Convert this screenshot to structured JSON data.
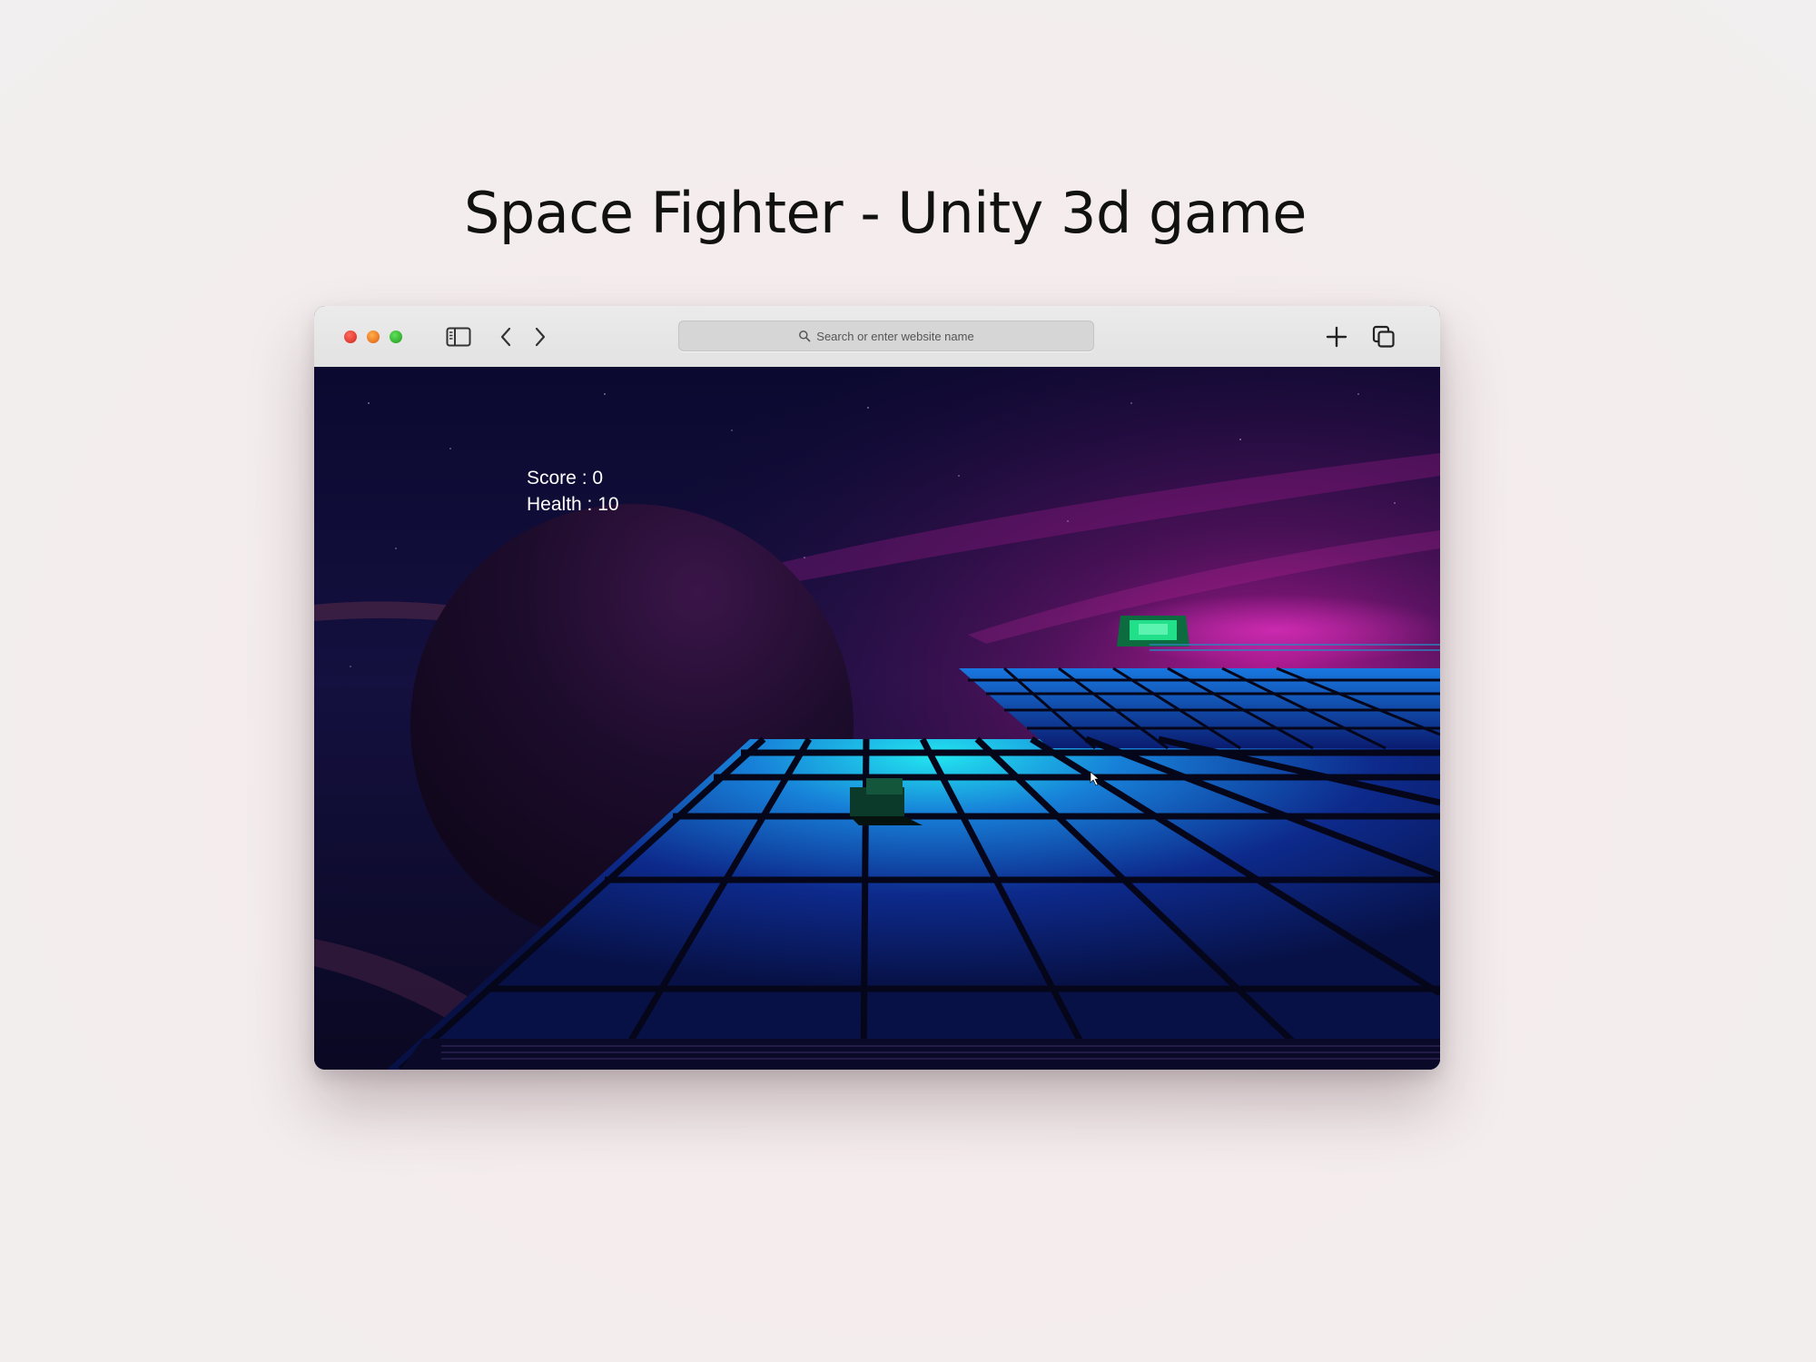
{
  "page": {
    "title": "Space Fighter - Unity 3d game"
  },
  "browser": {
    "address_placeholder": "Search or enter website name",
    "icons": {
      "sidebar": "sidebar-icon",
      "back": "chevron-left-icon",
      "forward": "chevron-right-icon",
      "search": "search-icon",
      "new_tab": "plus-icon",
      "tabs": "tabs-overview-icon"
    }
  },
  "game": {
    "hud": {
      "score_label": "Score : 0",
      "health_label": "Health : 10"
    },
    "colors": {
      "sky": "#0d0a33",
      "nebula": "#c2189a",
      "grid_glow": "#1ad6e6",
      "grid_tile": "#0c1a6a",
      "powerup": "#22e08a"
    }
  }
}
